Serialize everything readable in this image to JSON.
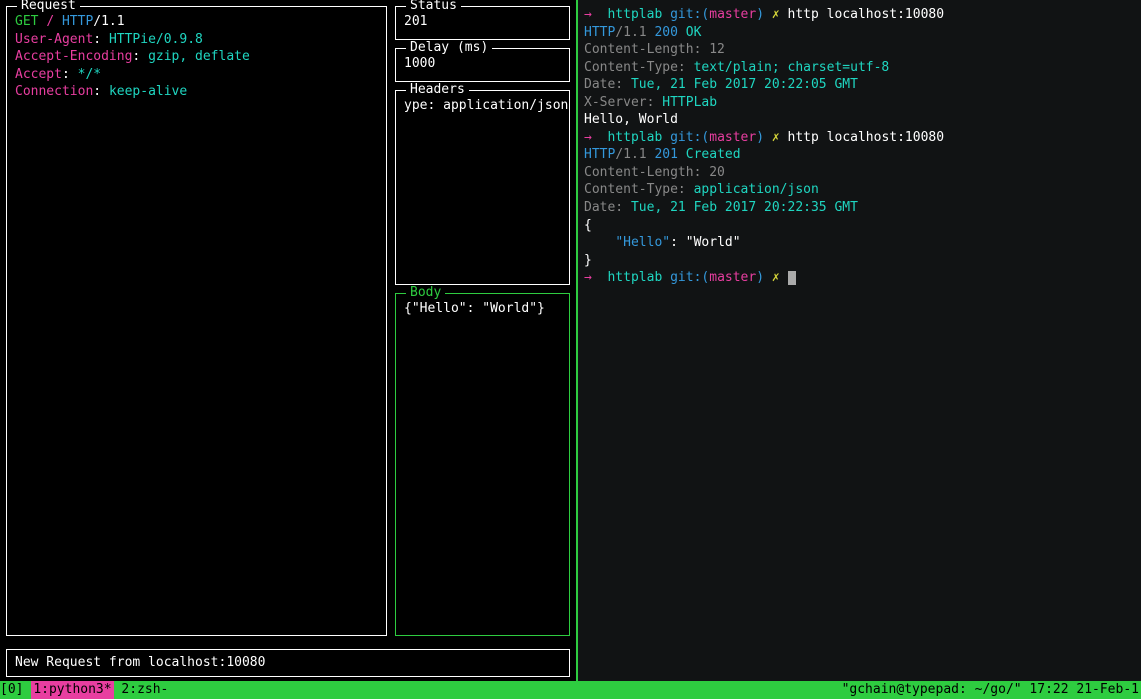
{
  "panels": {
    "request": {
      "title": "Request",
      "method": "GET",
      "path": "/",
      "proto1": "HTTP",
      "proto2": "/1.1",
      "headers": [
        {
          "k": "User-Agent",
          "sep": ": ",
          "v": "HTTPie/0.9.8"
        },
        {
          "k": "Accept-Encoding",
          "sep": ": ",
          "v": "gzip, deflate"
        },
        {
          "k": "Accept",
          "sep": ": ",
          "v": "*/*"
        },
        {
          "k": "Connection",
          "sep": ": ",
          "v": "keep-alive"
        }
      ]
    },
    "status": {
      "title": "Status",
      "value": "201"
    },
    "delay": {
      "title": "Delay (ms)",
      "value": "1000"
    },
    "headers": {
      "title": "Headers",
      "value": "ype: application/json"
    },
    "body": {
      "title": "Body",
      "value": "{\"Hello\": \"World\"}"
    },
    "message": "New Request from localhost:10080"
  },
  "term": {
    "prompt": {
      "arrow": "→ ",
      "dir": " httplab",
      "git1": " git:(",
      "branch": "master",
      "git2": ")",
      "dirty": " ✗ "
    },
    "cmd": "http localhost:10080",
    "resp1": {
      "proto": "HTTP",
      "ver": "/1.1 ",
      "code": "200 ",
      "msg": "OK",
      "h": [
        "Content-Length: 12",
        {
          "pre": "Content-Type: ",
          "val": "text/plain; charset=utf-8"
        },
        {
          "pre": "Date: ",
          "val": "Tue, 21 Feb 2017 20:22:05 GMT"
        },
        {
          "pre": "X-Server: ",
          "val": "HTTPLab"
        }
      ],
      "body": "Hello, World"
    },
    "resp2": {
      "proto": "HTTP",
      "ver": "/1.1 ",
      "code": "201 ",
      "msg": "Created",
      "h": [
        "Content-Length: 20",
        {
          "pre": "Content-Type: ",
          "val": "application/json"
        },
        {
          "pre": "Date: ",
          "val": "Tue, 21 Feb 2017 20:22:35 GMT"
        }
      ],
      "body": [
        "{",
        "    \"Hello\": \"World\"",
        "}"
      ]
    }
  },
  "statusbar": {
    "session": "[0] ",
    "win1": "1:python3*",
    "win2": " 2:zsh-",
    "right": "\"gchain@typepad: ~/go/\" 17:22 21-Feb-1"
  }
}
